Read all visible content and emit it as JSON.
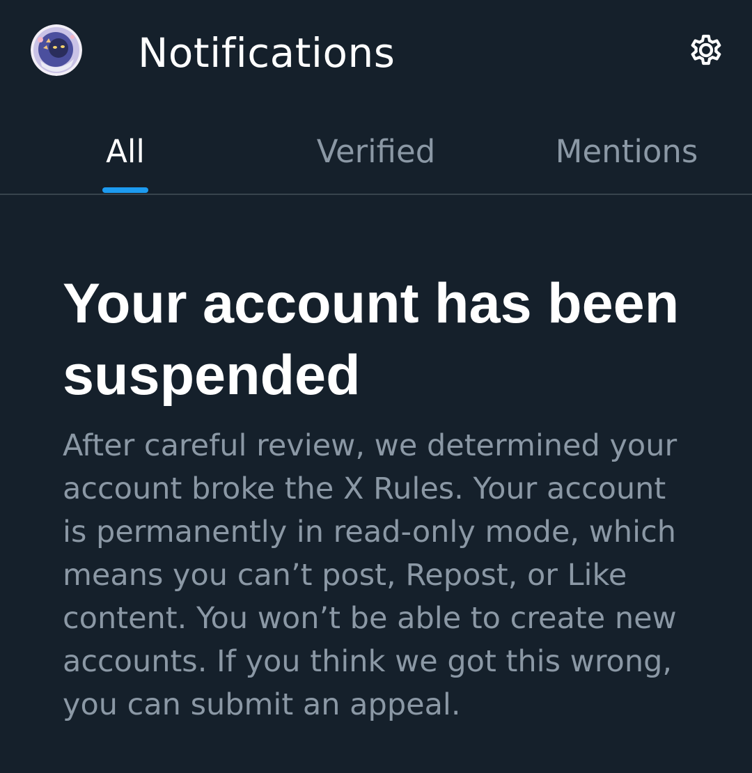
{
  "header": {
    "title": "Notifications",
    "avatar_icon": "profile-avatar",
    "settings_icon": "gear-icon"
  },
  "tabs": [
    {
      "label": "All",
      "active": true
    },
    {
      "label": "Verified",
      "active": false
    },
    {
      "label": "Mentions",
      "active": false
    }
  ],
  "suspension": {
    "title": "Your account has been suspended",
    "body": "After careful review, we determined your account broke the X Rules. Your account is permanently in read-only mode, which means you can’t post, Repost, or Like content. You won’t be able to create new accounts. If you think we got this wrong, you can submit an appeal."
  },
  "colors": {
    "background": "#15202b",
    "accent": "#1d9bf0",
    "muted_text": "#8b98a5",
    "divider": "#38444d"
  }
}
